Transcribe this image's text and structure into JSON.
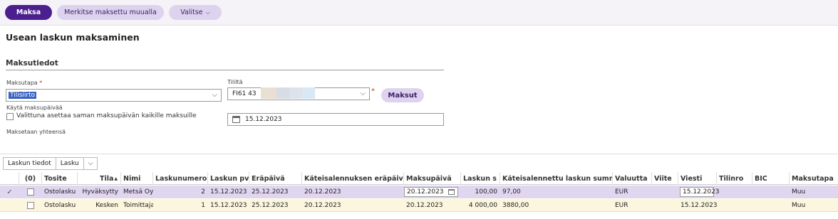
{
  "toolbar": {
    "pay_label": "Maksa",
    "mark_paid_label": "Merkitse maksettu muualla",
    "select_label": "Valitse"
  },
  "page": {
    "title": "Usean laskun maksaminen"
  },
  "section": {
    "title": "Maksutiedot"
  },
  "payment": {
    "method_label": "Maksutapa",
    "method_value": "Tilisiirto",
    "account_label": "Tililtä",
    "account_value": "FI61 43",
    "maksut_label": "Maksut",
    "use_date_label": "Käytä maksupäivää",
    "same_date_label": "Valittuna asettaa saman maksupäivän kaikille maksuille",
    "date_value": "15.12.2023",
    "total_label": "Maksetaan yhteensä"
  },
  "tabs": {
    "invoice_info": "Laskun tiedot",
    "invoice": "Lasku"
  },
  "table": {
    "headers": {
      "count": "(0)",
      "tosite": "Tosite",
      "tila": "Tila",
      "nimi": "Nimi",
      "laskunumero": "Laskunumero",
      "laskun_pvm": "Laskun pvm",
      "erapaiva": "Eräpäivä",
      "kateis_erapaiva": "Käteisalennuksen eräpäivä",
      "maksupaiva": "Maksupäivä",
      "laskun_summa": "Laskun s",
      "kateis_summa": "Käteisalennettu laskun summa",
      "valuutta": "Valuutta",
      "viite": "Viite",
      "viesti": "Viesti",
      "tilinro": "Tilinro",
      "bic": "BIC",
      "maksutapa": "Maksutapa"
    },
    "rows": [
      {
        "tosite": "Ostolasku",
        "tila": "Hyväksytty",
        "nimi": "Metsä Oy",
        "laskunumero": "2",
        "laskun_pvm": "15.12.2023",
        "erapaiva": "25.12.2023",
        "kateis_erapaiva": "20.12.2023",
        "maksupaiva": "20.12.2023",
        "laskun_summa": "100,00",
        "kateis_summa": "97,00",
        "valuutta": "EUR",
        "viite": "",
        "viesti": "15.12.2023",
        "tilinro": "",
        "bic": "",
        "maksutapa": "Muu"
      },
      {
        "tosite": "Ostolasku",
        "tila": "Kesken",
        "nimi": "Toimittaja",
        "laskunumero": "1",
        "laskun_pvm": "15.12.2023",
        "erapaiva": "25.12.2023",
        "kateis_erapaiva": "20.12.2023",
        "maksupaiva": "20.12.2023",
        "laskun_summa": "4 000,00",
        "kateis_summa": "3880,00",
        "valuutta": "EUR",
        "viite": "",
        "viesti": "15.12.2023",
        "tilinro": "",
        "bic": "",
        "maksutapa": "Muu"
      }
    ]
  },
  "colors": {
    "primary": "#4b1f8e",
    "secondary": "#ddd3ee",
    "selected_row": "#e1d6f0",
    "alt_row": "#fbf6dd",
    "required": "#c0392b"
  }
}
